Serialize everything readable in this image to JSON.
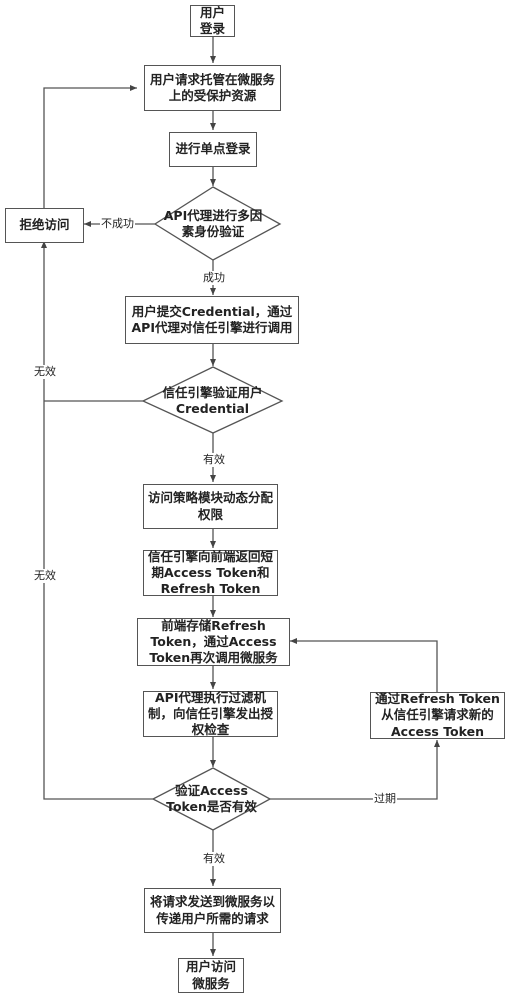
{
  "diagram": {
    "type": "flowchart",
    "nodes": {
      "start": "用户\n登录",
      "request": "用户请求托管在微服务\n上的受保护资源",
      "sso": "进行单点登录",
      "mfa": "API代理进行多因\n素身份验证",
      "deny": "拒绝访问",
      "submit": "用户提交Credential，通过\nAPI代理对信任引擎进行调用",
      "verify_cred": "信任引擎验证用户\nCredential",
      "policy": "访问策略模块动态分配\n权限",
      "issue_tokens": "信任引擎向前端返回短\n期Access Token和\nRefresh Token",
      "store": "前端存储Refresh\nToken，通过Access\nToken再次调用微服务",
      "filter": "API代理执行过滤机\n制，向信任引擎发出授\n权检查",
      "refresh": "通过Refresh Token\n从信任引擎请求新的\nAccess Token",
      "verify_token": "验证Access\nToken是否有效",
      "forward": "将请求发送到微服务以\n传递用户所需的请求",
      "end": "用户访问\n微服务"
    },
    "edge_labels": {
      "mfa_fail": "不成功",
      "mfa_success": "成功",
      "cred_invalid": "无效",
      "cred_valid": "有效",
      "token_invalid": "无效",
      "token_expired": "过期",
      "token_valid": "有效"
    },
    "colors": {
      "line": "#555555",
      "text": "#222222",
      "background": "#ffffff"
    }
  }
}
